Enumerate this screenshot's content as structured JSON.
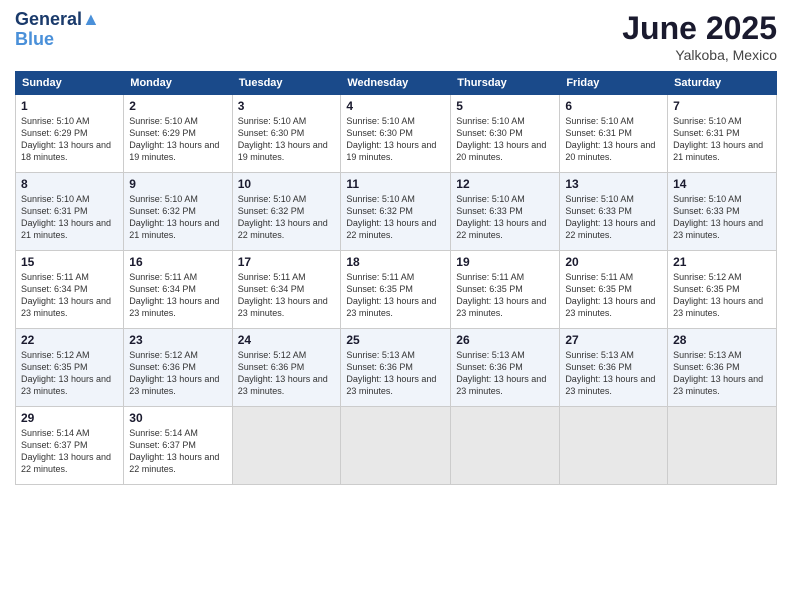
{
  "logo": {
    "line1": "General",
    "line2": "Blue"
  },
  "title": "June 2025",
  "location": "Yalkoba, Mexico",
  "weekdays": [
    "Sunday",
    "Monday",
    "Tuesday",
    "Wednesday",
    "Thursday",
    "Friday",
    "Saturday"
  ],
  "weeks": [
    [
      {
        "day": "1",
        "sunrise": "5:10 AM",
        "sunset": "6:29 PM",
        "daylight": "13 hours and 18 minutes."
      },
      {
        "day": "2",
        "sunrise": "5:10 AM",
        "sunset": "6:29 PM",
        "daylight": "13 hours and 19 minutes."
      },
      {
        "day": "3",
        "sunrise": "5:10 AM",
        "sunset": "6:30 PM",
        "daylight": "13 hours and 19 minutes."
      },
      {
        "day": "4",
        "sunrise": "5:10 AM",
        "sunset": "6:30 PM",
        "daylight": "13 hours and 19 minutes."
      },
      {
        "day": "5",
        "sunrise": "5:10 AM",
        "sunset": "6:30 PM",
        "daylight": "13 hours and 20 minutes."
      },
      {
        "day": "6",
        "sunrise": "5:10 AM",
        "sunset": "6:31 PM",
        "daylight": "13 hours and 20 minutes."
      },
      {
        "day": "7",
        "sunrise": "5:10 AM",
        "sunset": "6:31 PM",
        "daylight": "13 hours and 21 minutes."
      }
    ],
    [
      {
        "day": "8",
        "sunrise": "5:10 AM",
        "sunset": "6:31 PM",
        "daylight": "13 hours and 21 minutes."
      },
      {
        "day": "9",
        "sunrise": "5:10 AM",
        "sunset": "6:32 PM",
        "daylight": "13 hours and 21 minutes."
      },
      {
        "day": "10",
        "sunrise": "5:10 AM",
        "sunset": "6:32 PM",
        "daylight": "13 hours and 22 minutes."
      },
      {
        "day": "11",
        "sunrise": "5:10 AM",
        "sunset": "6:32 PM",
        "daylight": "13 hours and 22 minutes."
      },
      {
        "day": "12",
        "sunrise": "5:10 AM",
        "sunset": "6:33 PM",
        "daylight": "13 hours and 22 minutes."
      },
      {
        "day": "13",
        "sunrise": "5:10 AM",
        "sunset": "6:33 PM",
        "daylight": "13 hours and 22 minutes."
      },
      {
        "day": "14",
        "sunrise": "5:10 AM",
        "sunset": "6:33 PM",
        "daylight": "13 hours and 23 minutes."
      }
    ],
    [
      {
        "day": "15",
        "sunrise": "5:11 AM",
        "sunset": "6:34 PM",
        "daylight": "13 hours and 23 minutes."
      },
      {
        "day": "16",
        "sunrise": "5:11 AM",
        "sunset": "6:34 PM",
        "daylight": "13 hours and 23 minutes."
      },
      {
        "day": "17",
        "sunrise": "5:11 AM",
        "sunset": "6:34 PM",
        "daylight": "13 hours and 23 minutes."
      },
      {
        "day": "18",
        "sunrise": "5:11 AM",
        "sunset": "6:35 PM",
        "daylight": "13 hours and 23 minutes."
      },
      {
        "day": "19",
        "sunrise": "5:11 AM",
        "sunset": "6:35 PM",
        "daylight": "13 hours and 23 minutes."
      },
      {
        "day": "20",
        "sunrise": "5:11 AM",
        "sunset": "6:35 PM",
        "daylight": "13 hours and 23 minutes."
      },
      {
        "day": "21",
        "sunrise": "5:12 AM",
        "sunset": "6:35 PM",
        "daylight": "13 hours and 23 minutes."
      }
    ],
    [
      {
        "day": "22",
        "sunrise": "5:12 AM",
        "sunset": "6:35 PM",
        "daylight": "13 hours and 23 minutes."
      },
      {
        "day": "23",
        "sunrise": "5:12 AM",
        "sunset": "6:36 PM",
        "daylight": "13 hours and 23 minutes."
      },
      {
        "day": "24",
        "sunrise": "5:12 AM",
        "sunset": "6:36 PM",
        "daylight": "13 hours and 23 minutes."
      },
      {
        "day": "25",
        "sunrise": "5:13 AM",
        "sunset": "6:36 PM",
        "daylight": "13 hours and 23 minutes."
      },
      {
        "day": "26",
        "sunrise": "5:13 AM",
        "sunset": "6:36 PM",
        "daylight": "13 hours and 23 minutes."
      },
      {
        "day": "27",
        "sunrise": "5:13 AM",
        "sunset": "6:36 PM",
        "daylight": "13 hours and 23 minutes."
      },
      {
        "day": "28",
        "sunrise": "5:13 AM",
        "sunset": "6:36 PM",
        "daylight": "13 hours and 23 minutes."
      }
    ],
    [
      {
        "day": "29",
        "sunrise": "5:14 AM",
        "sunset": "6:37 PM",
        "daylight": "13 hours and 22 minutes."
      },
      {
        "day": "30",
        "sunrise": "5:14 AM",
        "sunset": "6:37 PM",
        "daylight": "13 hours and 22 minutes."
      },
      null,
      null,
      null,
      null,
      null
    ]
  ]
}
